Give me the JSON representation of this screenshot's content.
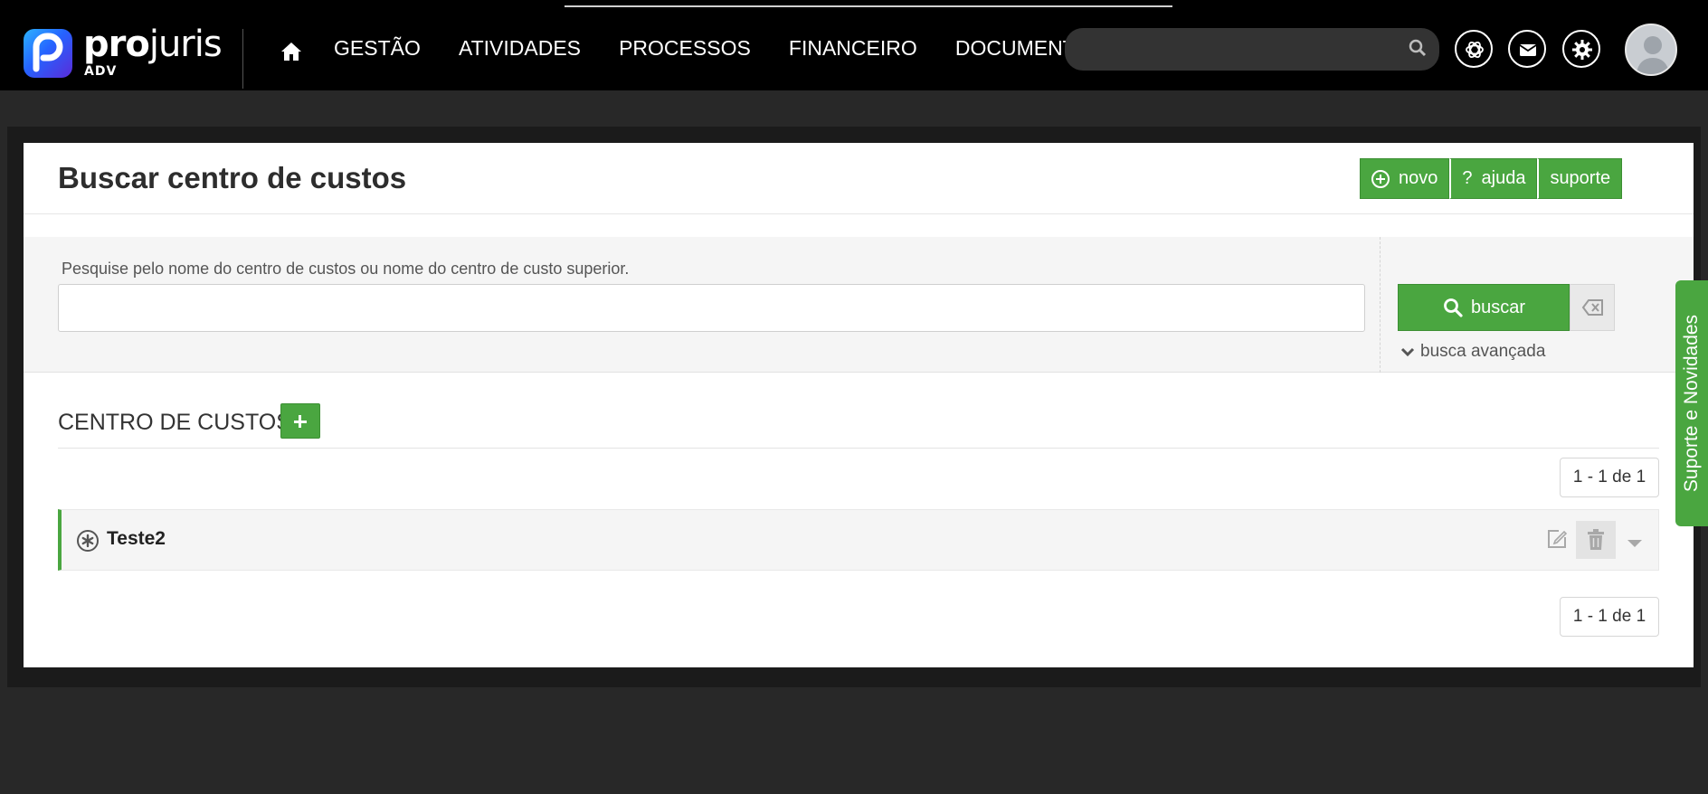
{
  "brand": {
    "name_bold": "pro",
    "name_light": "juris",
    "sub": "ADV"
  },
  "nav": {
    "items": [
      "GESTÃO",
      "ATIVIDADES",
      "PROCESSOS",
      "FINANCEIRO",
      "DOCUMENTOS"
    ]
  },
  "topbar": {
    "search_value": "",
    "icons": [
      "openai-icon",
      "mail-icon",
      "gear-icon"
    ]
  },
  "page": {
    "title": "Buscar centro de custos",
    "buttons": {
      "novo": "novo",
      "ajuda": "ajuda",
      "suporte": "suporte"
    }
  },
  "search": {
    "hint": "Pesquise pelo nome do centro de custos ou nome do centro de custo superior.",
    "value": "",
    "buscar_label": "buscar",
    "advanced_label": "busca avançada"
  },
  "list": {
    "section_title": "CENTRO DE CUSTOS",
    "pager_top": "1 - 1 de 1",
    "pager_bottom": "1 - 1 de 1",
    "rows": [
      {
        "label": "Teste2"
      }
    ]
  },
  "side_tab": {
    "label": "Suporte e Novidades"
  },
  "colors": {
    "accent": "#4aa640",
    "topbar": "#000000",
    "background": "#282828"
  }
}
